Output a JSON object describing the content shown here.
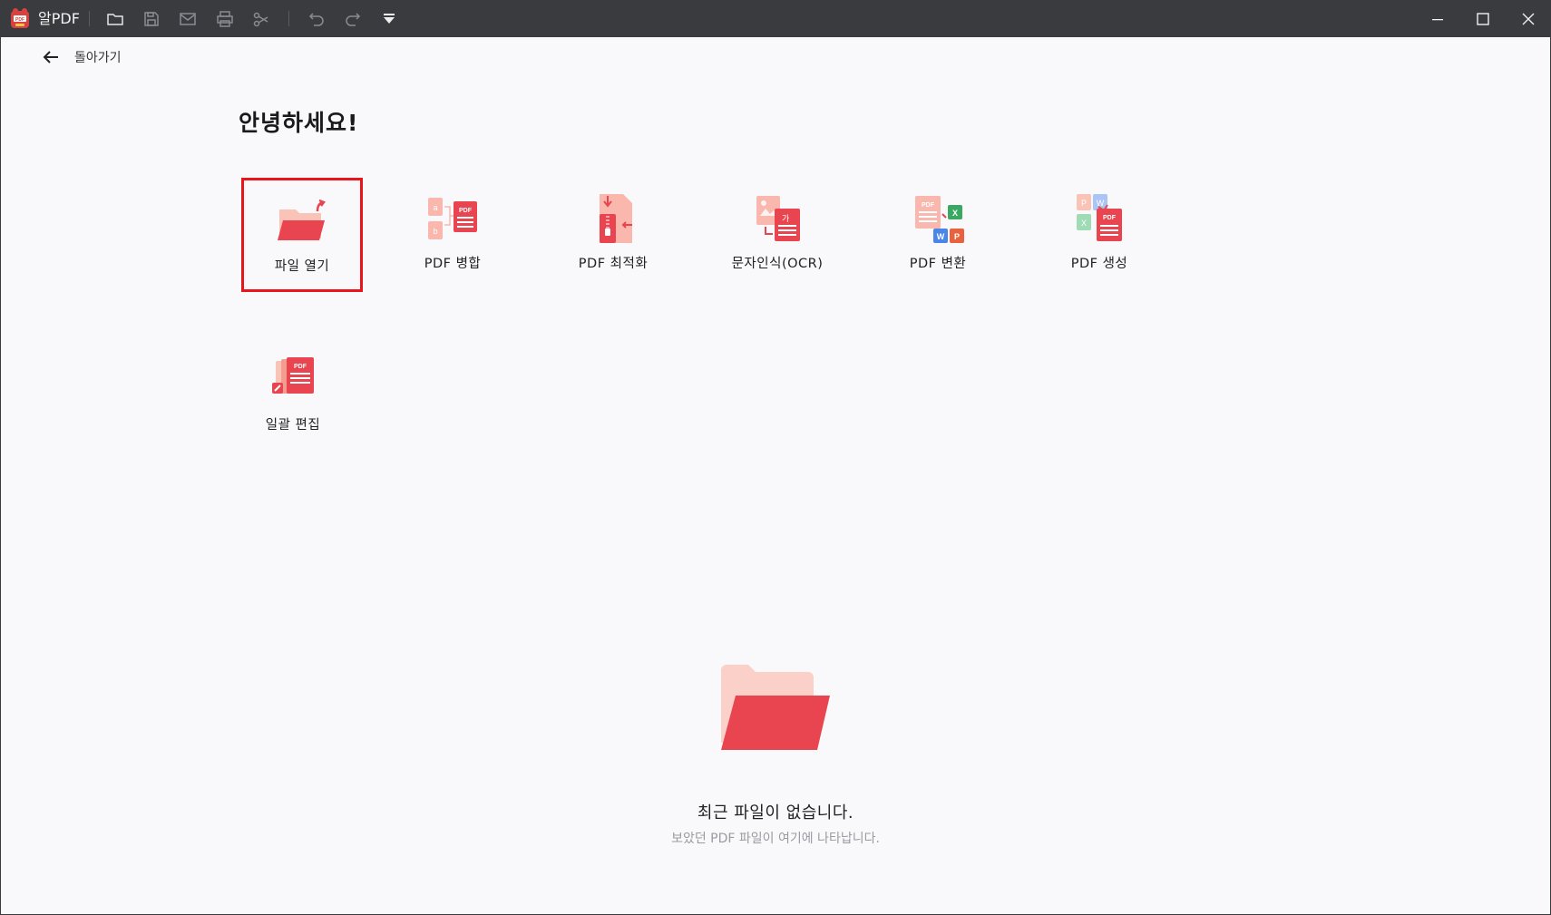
{
  "app": {
    "title": "알PDF"
  },
  "toolbar": {
    "icons": [
      "folder-open-icon",
      "save-icon",
      "mail-icon",
      "print-icon",
      "share-icon",
      "undo-icon",
      "redo-icon",
      "dropdown-icon"
    ]
  },
  "window_controls": [
    "minimize-icon",
    "maximize-icon",
    "close-icon"
  ],
  "nav": {
    "back_label": "돌아가기"
  },
  "main": {
    "greeting": "안녕하세요!",
    "tools": [
      {
        "label": "파일 열기",
        "icon": "open-file-icon"
      },
      {
        "label": "PDF 병합",
        "icon": "merge-pdf-icon"
      },
      {
        "label": "PDF 최적화",
        "icon": "optimize-pdf-icon"
      },
      {
        "label": "문자인식(OCR)",
        "icon": "ocr-icon"
      },
      {
        "label": "PDF 변환",
        "icon": "convert-pdf-icon"
      },
      {
        "label": "PDF 생성",
        "icon": "create-pdf-icon"
      },
      {
        "label": "일괄 편집",
        "icon": "batch-edit-icon"
      }
    ],
    "selected_tool": "파일 열기"
  },
  "recent": {
    "empty_title": "최근 파일이 없습니다.",
    "empty_subtitle": "보았던 PDF 파일이 여기에 나타납니다."
  },
  "colors": {
    "titlebar": "#3a3b3f",
    "accent_red": "#e84550",
    "accent_light": "#f9b7ad",
    "selection_border": "#e8161b",
    "background": "#f9f9fb"
  }
}
